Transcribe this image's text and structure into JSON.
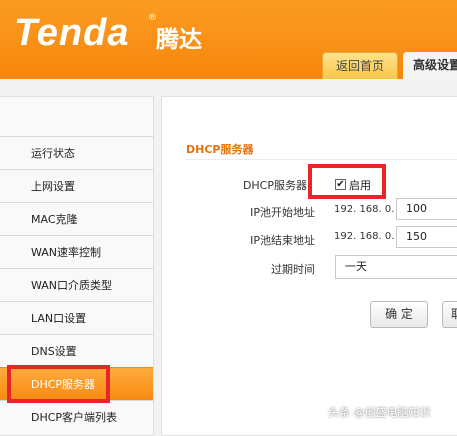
{
  "header": {
    "logo_text": "Tenda",
    "logo_reg": "®",
    "logo_cn": "腾达",
    "tabs": [
      {
        "label": "返回首页"
      },
      {
        "label": "高级设置"
      }
    ]
  },
  "sidebar": {
    "items": [
      {
        "label": "运行状态"
      },
      {
        "label": "上网设置"
      },
      {
        "label": "MAC克隆"
      },
      {
        "label": "WAN速率控制"
      },
      {
        "label": "WAN口介质类型"
      },
      {
        "label": "LAN口设置"
      },
      {
        "label": "DNS设置"
      },
      {
        "label": "DHCP服务器",
        "active": true
      },
      {
        "label": "DHCP客户端列表"
      }
    ]
  },
  "form": {
    "title": "DHCP服务器",
    "dhcp_server_label": "DHCP服务器",
    "enable_label": "启用",
    "enable_checked": true,
    "start_label": "IP池开始地址",
    "start_prefix": "192. 168. 0.",
    "start_value": "100",
    "end_label": "IP池结束地址",
    "end_prefix": "192. 168. 0.",
    "end_value": "150",
    "lease_label": "过期时间",
    "lease_value": "一天",
    "ok_label": "确 定",
    "cancel_label": "取"
  },
  "watermark": "头条 @创盛电脑知识",
  "colors": {
    "brand_orange": "#f7860d",
    "section_title": "#e9710d",
    "highlight_red": "#e8262a"
  }
}
